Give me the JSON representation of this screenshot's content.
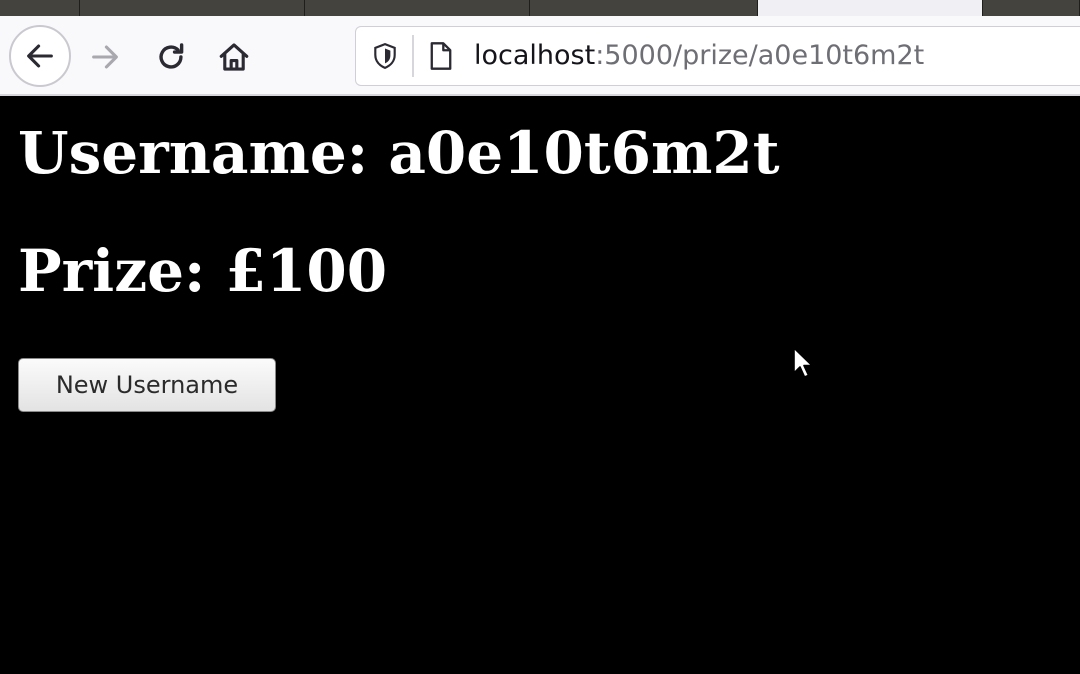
{
  "browser": {
    "url_host": "localhost",
    "url_path": ":5000/prize/a0e10t6m2t",
    "icons": {
      "back": "arrow-left-icon",
      "forward": "arrow-right-icon",
      "reload": "reload-icon",
      "home": "home-icon",
      "security": "shield-icon",
      "page": "page-icon"
    }
  },
  "page": {
    "username_line": "Username: a0e10t6m2t",
    "prize_line": "Prize: £100",
    "new_username_button": "New Username",
    "background_color": "#000000",
    "text_color": "#ffffff"
  }
}
